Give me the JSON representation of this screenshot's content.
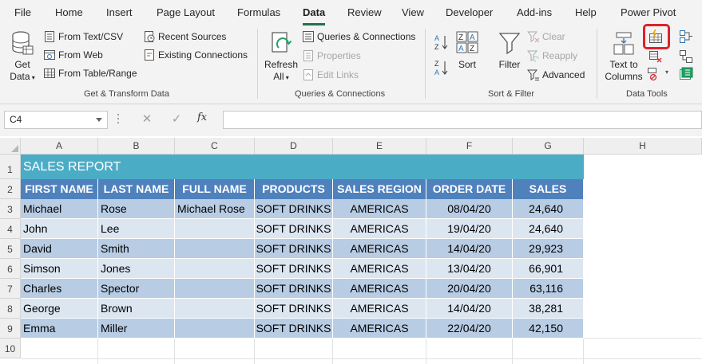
{
  "tabs": [
    "File",
    "Home",
    "Insert",
    "Page Layout",
    "Formulas",
    "Data",
    "Review",
    "View",
    "Developer",
    "Add-ins",
    "Help",
    "Power Pivot"
  ],
  "active_tab": "Data",
  "ribbon": {
    "get_transform": {
      "get_data_line1": "Get",
      "get_data_line2": "Data",
      "from_text_csv": "From Text/CSV",
      "from_web": "From Web",
      "from_table_range": "From Table/Range",
      "recent_sources": "Recent Sources",
      "existing_connections": "Existing Connections",
      "group_label": "Get & Transform Data"
    },
    "queries": {
      "refresh_all_line1": "Refresh",
      "refresh_all_line2": "All",
      "queries_connections": "Queries & Connections",
      "properties": "Properties",
      "edit_links": "Edit Links",
      "group_label": "Queries & Connections"
    },
    "sort_filter": {
      "sort": "Sort",
      "filter": "Filter",
      "clear": "Clear",
      "reapply": "Reapply",
      "advanced": "Advanced",
      "group_label": "Sort & Filter"
    },
    "data_tools": {
      "text_to_columns_line1": "Text to",
      "text_to_columns_line2": "Columns",
      "group_label": "Data Tools"
    }
  },
  "formula_bar": {
    "name_box": "C4",
    "fx_label": "fx",
    "cancel_symbol": "✕",
    "enter_symbol": "✓",
    "formula": ""
  },
  "columns": [
    "A",
    "B",
    "C",
    "D",
    "E",
    "F",
    "G",
    "H"
  ],
  "rows": [
    "1",
    "2",
    "3",
    "4",
    "5",
    "6",
    "7",
    "8",
    "9",
    "10"
  ],
  "sheet": {
    "title": "SALES REPORT",
    "headers": [
      "FIRST NAME",
      "LAST NAME",
      "FULL NAME",
      "PRODUCTS",
      "SALES REGION",
      "ORDER DATE",
      "SALES"
    ],
    "records": [
      [
        "Michael",
        "Rose",
        "Michael Rose",
        "SOFT DRINKS",
        "AMERICAS",
        "08/04/20",
        "24,640"
      ],
      [
        "John",
        "Lee",
        "",
        "SOFT DRINKS",
        "AMERICAS",
        "19/04/20",
        "24,640"
      ],
      [
        "David",
        "Smith",
        "",
        "SOFT DRINKS",
        "AMERICAS",
        "14/04/20",
        "29,923"
      ],
      [
        "Simson",
        "Jones",
        "",
        "SOFT DRINKS",
        "AMERICAS",
        "13/04/20",
        "66,901"
      ],
      [
        "Charles",
        "Spector",
        "",
        "SOFT DRINKS",
        "AMERICAS",
        "20/04/20",
        "63,116"
      ],
      [
        "George",
        "Brown",
        "",
        "SOFT DRINKS",
        "AMERICAS",
        "14/04/20",
        "38,281"
      ],
      [
        "Emma",
        "Miller",
        "",
        "SOFT DRINKS",
        "AMERICAS",
        "22/04/20",
        "42,150"
      ]
    ]
  },
  "colors": {
    "title_band": "#4bacc6",
    "header_band": "#4f81bd",
    "row_band_dark": "#b8cce4",
    "row_band_light": "#dce6f1",
    "highlight": "#e0202a",
    "accent": "#217346"
  },
  "highlighted_control": "flash-fill-icon"
}
